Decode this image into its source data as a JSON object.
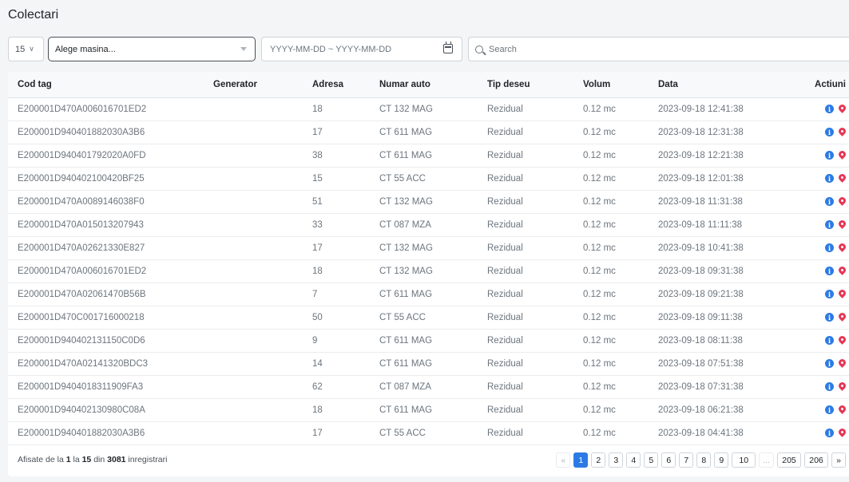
{
  "page": {
    "title": "Colectari"
  },
  "toolbar": {
    "page_size": "15",
    "car_select_placeholder": "Alege masina...",
    "date_range_placeholder": "YYYY-MM-DD ~ YYYY-MM-DD",
    "search_placeholder": "Search"
  },
  "table": {
    "headers": [
      "Cod tag",
      "Generator",
      "Adresa",
      "Numar auto",
      "Tip deseu",
      "Volum",
      "Data",
      "Actiuni"
    ],
    "rows": [
      [
        "E200001D470A006016701ED2",
        "",
        "18",
        "CT 132 MAG",
        "Rezidual",
        "0.12 mc",
        "2023-09-18 12:41:38"
      ],
      [
        "E200001D940401882030A3B6",
        "",
        "17",
        "CT 611 MAG",
        "Rezidual",
        "0.12 mc",
        "2023-09-18 12:31:38"
      ],
      [
        "E200001D940401792020A0FD",
        "",
        "38",
        "CT 611 MAG",
        "Rezidual",
        "0.12 mc",
        "2023-09-18 12:21:38"
      ],
      [
        "E200001D940402100420BF25",
        "",
        "15",
        "CT 55 ACC",
        "Rezidual",
        "0.12 mc",
        "2023-09-18 12:01:38"
      ],
      [
        "E200001D470A0089146038F0",
        "",
        "51",
        "CT 132 MAG",
        "Rezidual",
        "0.12 mc",
        "2023-09-18 11:31:38"
      ],
      [
        "E200001D470A015013207943",
        "",
        "33",
        "CT 087 MZA",
        "Rezidual",
        "0.12 mc",
        "2023-09-18 11:11:38"
      ],
      [
        "E200001D470A02621330E827",
        "",
        "17",
        "CT 132 MAG",
        "Rezidual",
        "0.12 mc",
        "2023-09-18 10:41:38"
      ],
      [
        "E200001D470A006016701ED2",
        "",
        "18",
        "CT 132 MAG",
        "Rezidual",
        "0.12 mc",
        "2023-09-18 09:31:38"
      ],
      [
        "E200001D470A02061470B56B",
        "",
        "7",
        "CT 611 MAG",
        "Rezidual",
        "0.12 mc",
        "2023-09-18 09:21:38"
      ],
      [
        "E200001D470C001716000218",
        "",
        "50",
        "CT 55 ACC",
        "Rezidual",
        "0.12 mc",
        "2023-09-18 09:11:38"
      ],
      [
        "E200001D940402131150C0D6",
        "",
        "9",
        "CT 611 MAG",
        "Rezidual",
        "0.12 mc",
        "2023-09-18 08:11:38"
      ],
      [
        "E200001D470A02141320BDC3",
        "",
        "14",
        "CT 611 MAG",
        "Rezidual",
        "0.12 mc",
        "2023-09-18 07:51:38"
      ],
      [
        "E200001D9404018311909FA3",
        "",
        "62",
        "CT 087 MZA",
        "Rezidual",
        "0.12 mc",
        "2023-09-18 07:31:38"
      ],
      [
        "E200001D940402130980C08A",
        "",
        "18",
        "CT 611 MAG",
        "Rezidual",
        "0.12 mc",
        "2023-09-18 06:21:38"
      ],
      [
        "E200001D940401882030A3B6",
        "",
        "17",
        "CT 55 ACC",
        "Rezidual",
        "0.12 mc",
        "2023-09-18 04:41:38"
      ]
    ]
  },
  "footer": {
    "summary_prefix": "Afisate de la",
    "from": "1",
    "to_word": "la",
    "to": "15",
    "of_word": "din",
    "total": "3081",
    "suffix": "inregistrari"
  },
  "pagination": {
    "prev": "«",
    "pages": [
      "1",
      "2",
      "3",
      "4",
      "5",
      "6",
      "7",
      "8",
      "9",
      "10"
    ],
    "ellipsis": "...",
    "tail_pages": [
      "205",
      "206"
    ],
    "next": "»",
    "active": "1"
  },
  "colors": {
    "accent": "#2c7be5",
    "danger": "#e63757"
  },
  "icons": {
    "info": "info-icon",
    "location": "map-pin-icon",
    "calendar": "calendar-icon",
    "search": "search-icon"
  }
}
